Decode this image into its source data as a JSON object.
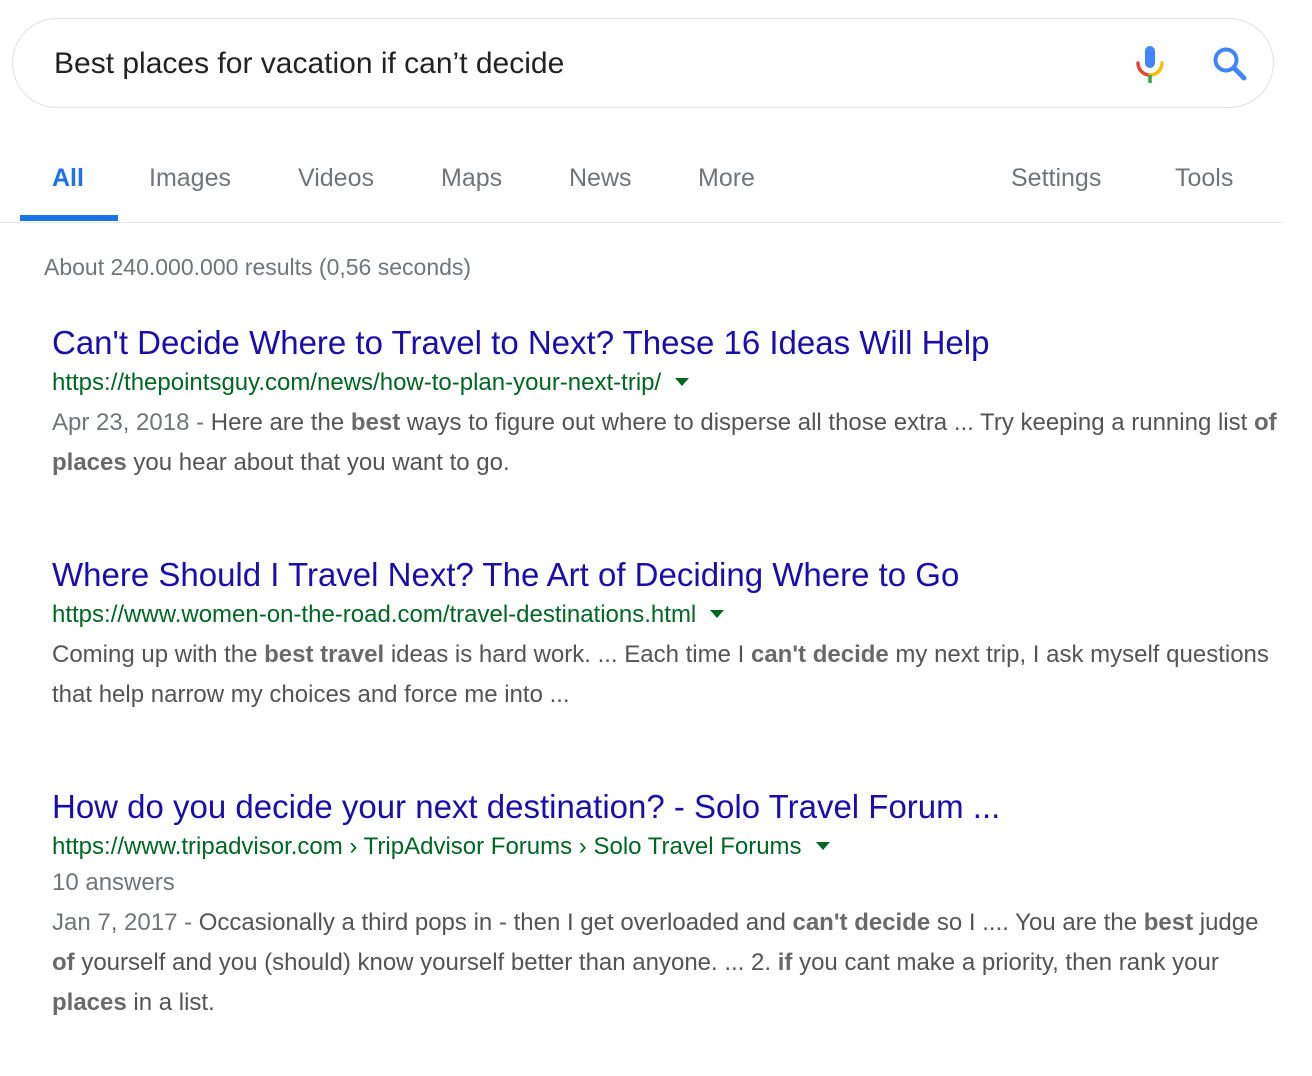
{
  "search": {
    "query": "Best places for vacation if can’t decide"
  },
  "icons": {
    "mic": "microphone-icon",
    "search": "search-icon",
    "dropdown": "caret-down-icon"
  },
  "colors": {
    "accent": "#1a73e8",
    "link": "#1a0dab",
    "url": "#006621",
    "muted": "#70757a",
    "mic_blue": "#4285f4",
    "mic_red": "#ea4335",
    "mic_yellow": "#fbbc05",
    "mic_green": "#34a853"
  },
  "tabs": {
    "all": "All",
    "images": "Images",
    "videos": "Videos",
    "maps": "Maps",
    "news": "News",
    "more": "More",
    "settings": "Settings",
    "tools": "Tools"
  },
  "stats": "About 240.000.000 results (0,56 seconds)",
  "results": [
    {
      "title": "Can't Decide Where to Travel to Next? These 16 Ideas Will Help",
      "url": "https://thepointsguy.com/news/how-to-plan-your-next-trip/",
      "date": "Apr 23, 2018",
      "snippet": [
        {
          "t": "Here are the ",
          "b": false
        },
        {
          "t": "best",
          "b": true
        },
        {
          "t": " ways to figure out where to disperse all those extra ... Try keeping a running list ",
          "b": false
        },
        {
          "t": "of places",
          "b": true
        },
        {
          "t": " you hear about that you want to go.",
          "b": false
        }
      ]
    },
    {
      "title": "Where Should I Travel Next? The Art of Deciding Where to Go",
      "url": "https://www.women-on-the-road.com/travel-destinations.html",
      "snippet": [
        {
          "t": "Coming up with the ",
          "b": false
        },
        {
          "t": "best travel",
          "b": true
        },
        {
          "t": " ideas is hard work. ... Each time I ",
          "b": false
        },
        {
          "t": "can't decide",
          "b": true
        },
        {
          "t": " my next trip, I ask myself questions that help narrow my choices and force me into ...",
          "b": false
        }
      ]
    },
    {
      "title": "How do you decide your next destination? - Solo Travel Forum ...",
      "url": "https://www.tripadvisor.com › TripAdvisor Forums › Solo Travel Forums",
      "answers": "10 answers",
      "date": "Jan 7, 2017",
      "snippet": [
        {
          "t": "Occasionally a third pops in - then I get overloaded and ",
          "b": false
        },
        {
          "t": "can't decide",
          "b": true
        },
        {
          "t": " so I .... You are the ",
          "b": false
        },
        {
          "t": "best",
          "b": true
        },
        {
          "t": " judge ",
          "b": false
        },
        {
          "t": "of",
          "b": true
        },
        {
          "t": " yourself and you (should) know yourself better than anyone. ... 2. ",
          "b": false
        },
        {
          "t": "if",
          "b": true
        },
        {
          "t": " you cant make a priority, then rank your ",
          "b": false
        },
        {
          "t": "places",
          "b": true
        },
        {
          "t": " in a list.",
          "b": false
        }
      ]
    }
  ]
}
